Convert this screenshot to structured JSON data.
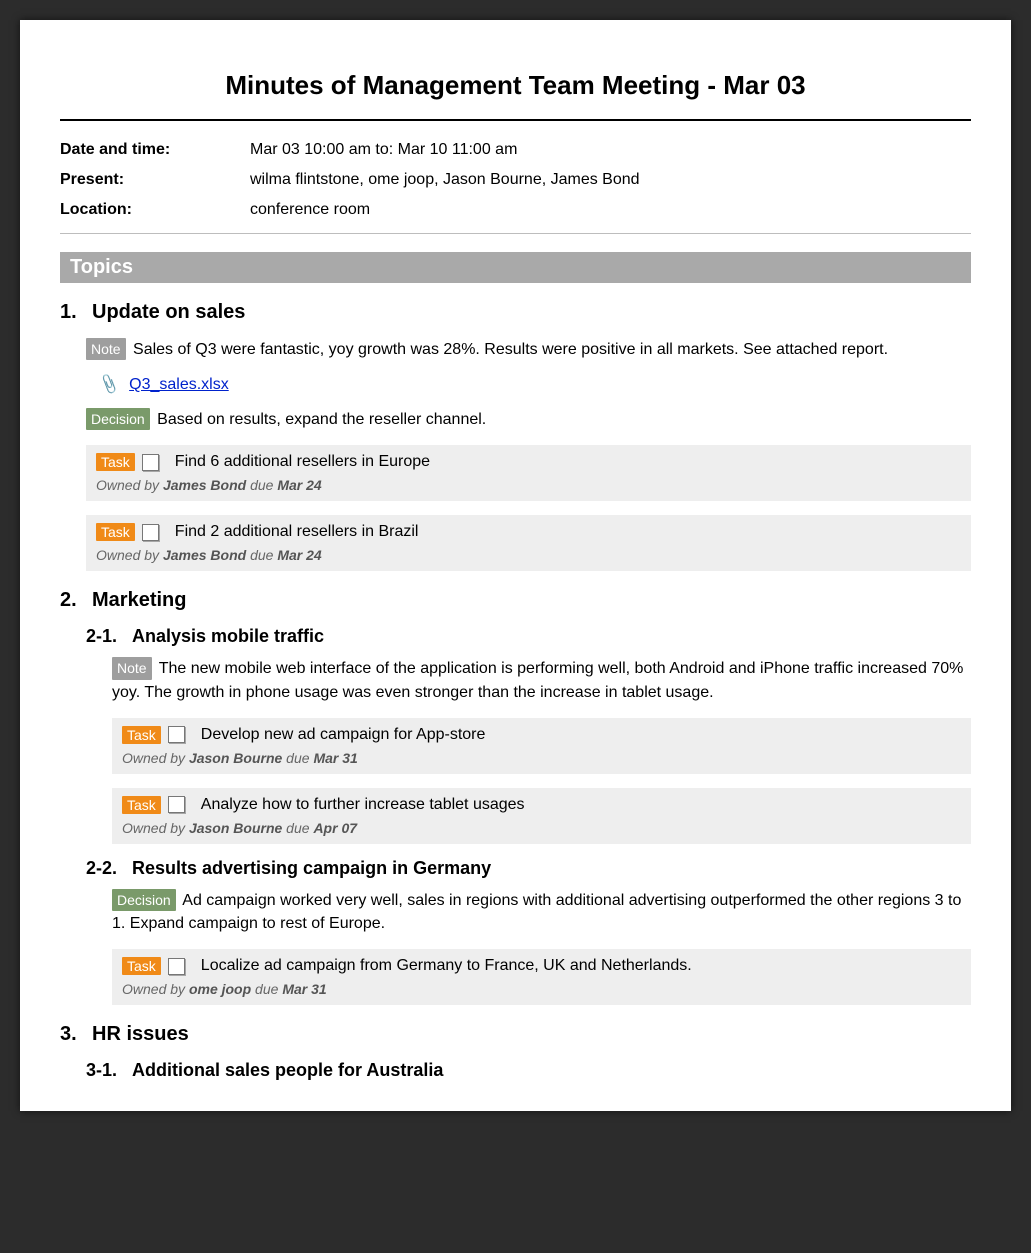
{
  "title": "Minutes of Management Team Meeting - Mar 03",
  "meta": {
    "date_label": "Date and time:",
    "date_value": "Mar 03 10:00 am to: Mar 10 11:00 am",
    "present_label": "Present:",
    "present_value": "wilma flintstone, ome joop, Jason Bourne, James Bond",
    "location_label": "Location:",
    "location_value": "conference room"
  },
  "topics_heading": "Topics",
  "tags": {
    "note": "Note",
    "decision": "Decision",
    "task": "Task"
  },
  "topic1": {
    "num": "1.",
    "title": "Update on sales",
    "note": "Sales of Q3 were fantastic, yoy growth was 28%. Results were positive in all markets. See attached report.",
    "attachment": "Q3_sales.xlsx",
    "decision": "Based on results, expand the reseller channel.",
    "task1": {
      "text": "Find 6 additional resellers in Europe",
      "owned_by_label": "Owned by ",
      "owner": "James Bond",
      "due_label": "  due ",
      "due": "Mar 24"
    },
    "task2": {
      "text": "Find 2 additional resellers in Brazil",
      "owned_by_label": "Owned by ",
      "owner": "James Bond",
      "due_label": "  due ",
      "due": "Mar 24"
    }
  },
  "topic2": {
    "num": "2.",
    "title": "Marketing",
    "sub1": {
      "num": "2-1.",
      "title": "Analysis mobile traffic",
      "note": "The new mobile web interface of the application is performing well, both Android and iPhone traffic increased 70% yoy. The growth in phone usage was even stronger than the increase in tablet usage.",
      "task1": {
        "text": "Develop new ad campaign for App-store",
        "owned_by_label": "Owned by ",
        "owner": "Jason Bourne",
        "due_label": "  due ",
        "due": "Mar 31"
      },
      "task2": {
        "text": "Analyze how to further increase tablet usages",
        "owned_by_label": "Owned by ",
        "owner": "Jason Bourne",
        "due_label": "  due ",
        "due": "Apr 07"
      }
    },
    "sub2": {
      "num": "2-2.",
      "title": "Results advertising campaign in Germany",
      "decision": "Ad campaign worked very well, sales in regions with additional advertising outperformed the other regions 3 to 1. Expand campaign to rest of Europe.",
      "task1": {
        "text": "Localize ad campaign from Germany to France, UK and Netherlands.",
        "owned_by_label": "Owned by ",
        "owner": "ome joop",
        "due_label": "  due ",
        "due": "Mar 31"
      }
    }
  },
  "topic3": {
    "num": "3.",
    "title": "HR issues",
    "sub1": {
      "num": "3-1.",
      "title": "Additional sales people for Australia"
    }
  }
}
